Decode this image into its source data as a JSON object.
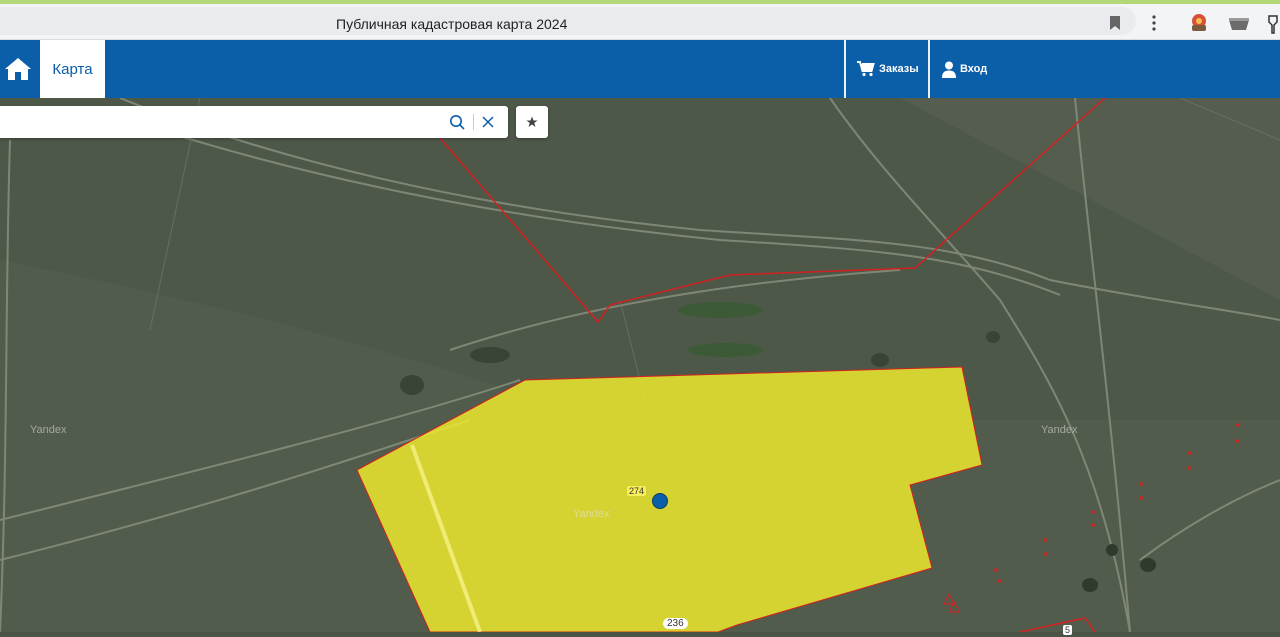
{
  "browser": {
    "tab_title": "Публичная кадастровая карта 2024"
  },
  "header": {
    "home_icon": "home-icon",
    "map_tab_label": "Карта",
    "orders_label": "Заказы",
    "login_label": "Вход",
    "brand_color": "#0b5ea8"
  },
  "search": {
    "value": "",
    "placeholder": ""
  },
  "map": {
    "watermark_left": "Yandex",
    "watermark_center": "Yandex",
    "watermark_right": "Yandex",
    "parcel_label_main": "274",
    "parcel_label_bottom": "236",
    "parcel_label_corner": "5",
    "highlight_color": "#f2ee2c",
    "boundary_color": "#d42020"
  }
}
